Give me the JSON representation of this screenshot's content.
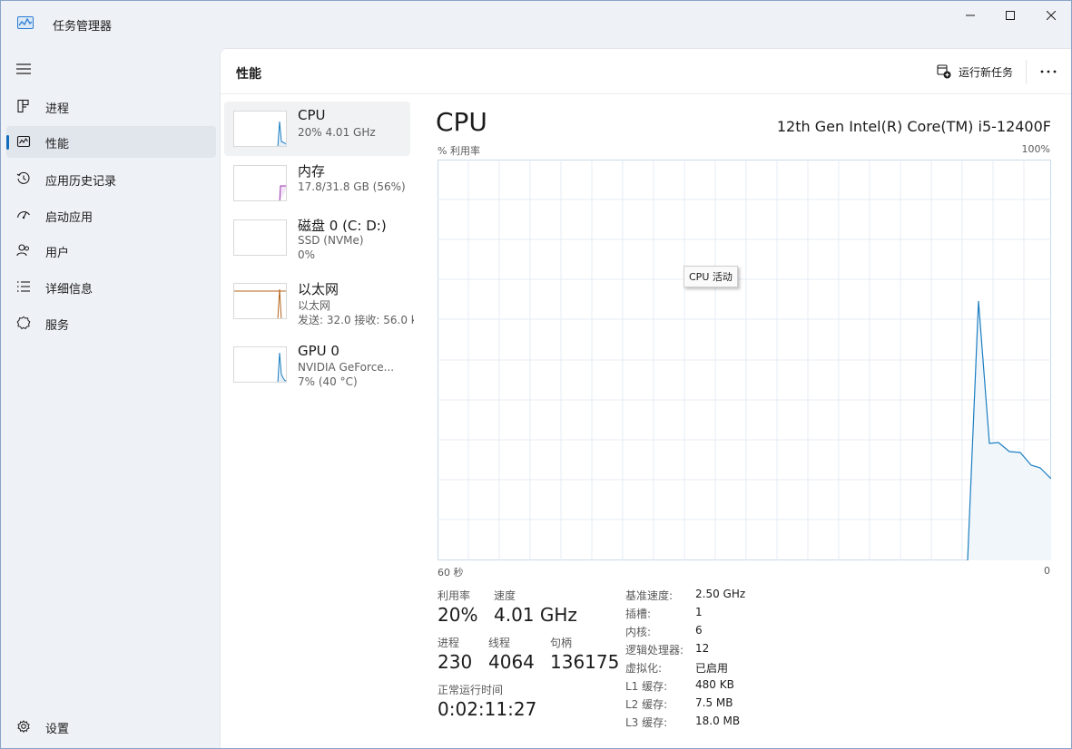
{
  "app": {
    "title": "任务管理器"
  },
  "nav": {
    "items": [
      {
        "label": "进程",
        "icon": "processes-icon"
      },
      {
        "label": "性能",
        "icon": "performance-icon",
        "active": true
      },
      {
        "label": "应用历史记录",
        "icon": "history-icon"
      },
      {
        "label": "启动应用",
        "icon": "startup-icon"
      },
      {
        "label": "用户",
        "icon": "users-icon"
      },
      {
        "label": "详细信息",
        "icon": "details-icon"
      },
      {
        "label": "服务",
        "icon": "services-icon"
      }
    ],
    "settings_label": "设置"
  },
  "header": {
    "title": "性能",
    "run_task_label": "运行新任务"
  },
  "devices": [
    {
      "name": "CPU",
      "lines": [
        "20% 4.01 GHz"
      ],
      "color": "#1b7ec1"
    },
    {
      "name": "内存",
      "lines": [
        "17.8/31.8 GB (56%)"
      ],
      "color": "#9b2fae"
    },
    {
      "name": "磁盘 0 (C: D:)",
      "lines": [
        "SSD (NVMe)",
        "0%"
      ],
      "color": "#4e9a06"
    },
    {
      "name": "以太网",
      "lines": [
        "以太网",
        "发送: 32.0  接收: 56.0 k"
      ],
      "color": "#b5651d"
    },
    {
      "name": "GPU 0",
      "lines": [
        "NVIDIA GeForce...",
        "7% (40 °C)"
      ],
      "color": "#1b7ec1"
    }
  ],
  "cpu": {
    "title": "CPU",
    "model": "12th Gen Intel(R) Core(TM) i5-12400F",
    "graph_label": "% 利用率",
    "graph_max": "100%",
    "axis_left": "60 秒",
    "axis_right": "0",
    "tooltip": "CPU 活动",
    "line_color": "#1b7ec1",
    "stats": {
      "util_label": "利用率",
      "util_value": "20%",
      "speed_label": "速度",
      "speed_value": "4.01 GHz",
      "proc_label": "进程",
      "proc_value": "230",
      "thread_label": "线程",
      "thread_value": "4064",
      "handle_label": "句柄",
      "handle_value": "136175",
      "uptime_label": "正常运行时间",
      "uptime_value": "0:02:11:27"
    },
    "specs": [
      {
        "label": "基准速度:",
        "value": "2.50 GHz"
      },
      {
        "label": "插槽:",
        "value": "1"
      },
      {
        "label": "内核:",
        "value": "6"
      },
      {
        "label": "逻辑处理器:",
        "value": "12"
      },
      {
        "label": "虚拟化:",
        "value": "已启用"
      },
      {
        "label": "L1 缓存:",
        "value": "480 KB"
      },
      {
        "label": "L2 缓存:",
        "value": "7.5 MB"
      },
      {
        "label": "L3 缓存:",
        "value": "18.0 MB"
      }
    ]
  }
}
